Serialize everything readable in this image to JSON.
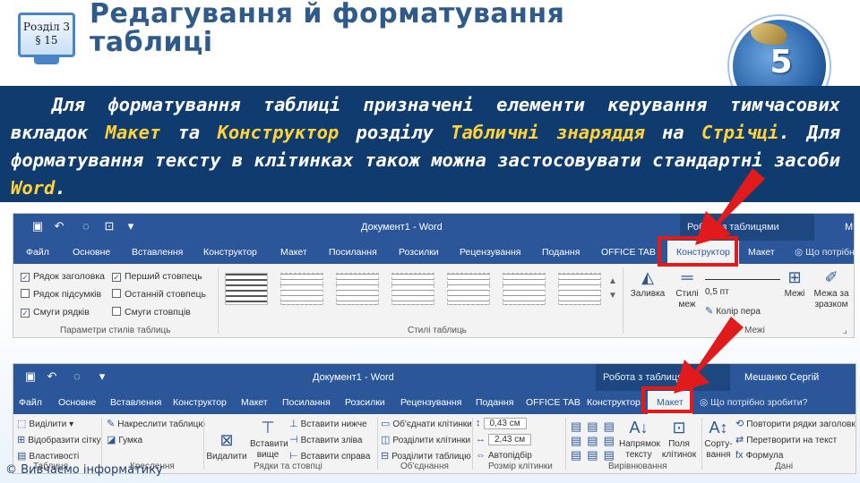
{
  "header": {
    "badge_section": "Розділ 3",
    "badge_paragraph": "§ 15",
    "title_line1": "Редагування й форматування",
    "title_line2": "таблиці",
    "logo_number": "5"
  },
  "body_text": {
    "seg1": "Для форматування таблиці призначені елементи керування тимчасових вкладок ",
    "hl1": "Макет",
    "seg2": " та ",
    "hl2": "Конструктор",
    "seg3": " розділу ",
    "hl3": "Табличні знаряддя",
    "seg4": " на ",
    "hl4": "Стрічці",
    "seg5": ". Для форматування тексту в клітинках також можна застосовувати стандартні засоби ",
    "hl5": "Word",
    "seg6": "."
  },
  "colors": {
    "band": "#0f3b6e",
    "highlight": "#ffd23a",
    "title": "#2e5a8c",
    "ribbon_blue": "#2b579a",
    "red_marker": "#e11b1b"
  },
  "ribbon1": {
    "doc_title": "Документ1 - Word",
    "context_group": "Робота з таблицями",
    "user_fragment": "М",
    "tabs": [
      "Файл",
      "Основне",
      "Вставлення",
      "Конструктор",
      "Макет",
      "Посилання",
      "Розсилки",
      "Рецензування",
      "Подання",
      "OFFICE TAB",
      "Конструктор",
      "Макет"
    ],
    "search": "Що потрібн",
    "checkboxes": [
      {
        "label": "Рядок заголовка",
        "checked": true
      },
      {
        "label": "Перший стовпець",
        "checked": true
      },
      {
        "label": "Рядок підсумків",
        "checked": false
      },
      {
        "label": "Останній стовпець",
        "checked": false
      },
      {
        "label": "Смуги рядків",
        "checked": true
      },
      {
        "label": "Смуги стовпців",
        "checked": false
      }
    ],
    "group_style_options": "Параметри стилів таблиць",
    "group_styles": "Стилі таблиць",
    "group_borders": "Межі",
    "btn_fill": "Заливка",
    "btn_border_styles_1": "Стилі",
    "btn_border_styles_2": "меж",
    "pen_weight": "0,5 пт",
    "pen_color": "Колір пера",
    "btn_borders": "Межі",
    "btn_border_painter_1": "Межа за",
    "btn_border_painter_2": "зразком"
  },
  "ribbon2": {
    "doc_title": "Документ1 - Word",
    "context_group": "Робота з таблицями",
    "user_name": "Мешанко Сергій",
    "tabs": [
      "Файл",
      "Основне",
      "Вставлення",
      "Конструктор",
      "Макет",
      "Посилання",
      "Розсилки",
      "Рецензування",
      "Подання",
      "OFFICE TAB",
      "Конструктор",
      "Макет"
    ],
    "search": "Що потрібно зробити?",
    "table_items": [
      "Виділити",
      "Відобразити сітку",
      "Властивості"
    ],
    "draw_items": [
      "Накреслити таблицю",
      "Гумка"
    ],
    "delete_label_1": "Видалити",
    "insert_above_1": "Вставити",
    "insert_above_2": "вище",
    "insert_items": [
      "Вставити нижче",
      "Вставити зліва",
      "Вставити справа"
    ],
    "merge_items": [
      "Об'єднати клітинки",
      "Розділити клітинки",
      "Розділити таблицю"
    ],
    "cell_height": "0,43 см",
    "cell_width": "2,43 см",
    "autofit": "Автопідбір",
    "direction_1": "Напрямок",
    "direction_2": "тексту",
    "margins_1": "Поля",
    "margins_2": "клітинок",
    "sort_1": "Сорту-",
    "sort_2": "вання",
    "data_items": [
      "Повторити рядки заголовків",
      "Перетворити на текст",
      "Формула"
    ],
    "groups": [
      "Таблиця",
      "Креслення",
      "Рядки та стовпці",
      "Об'єднання",
      "Розмір клітинки",
      "Вирівнювання",
      "Дані"
    ]
  },
  "footer": {
    "copyright": "© Вивчаємо інформатику"
  }
}
